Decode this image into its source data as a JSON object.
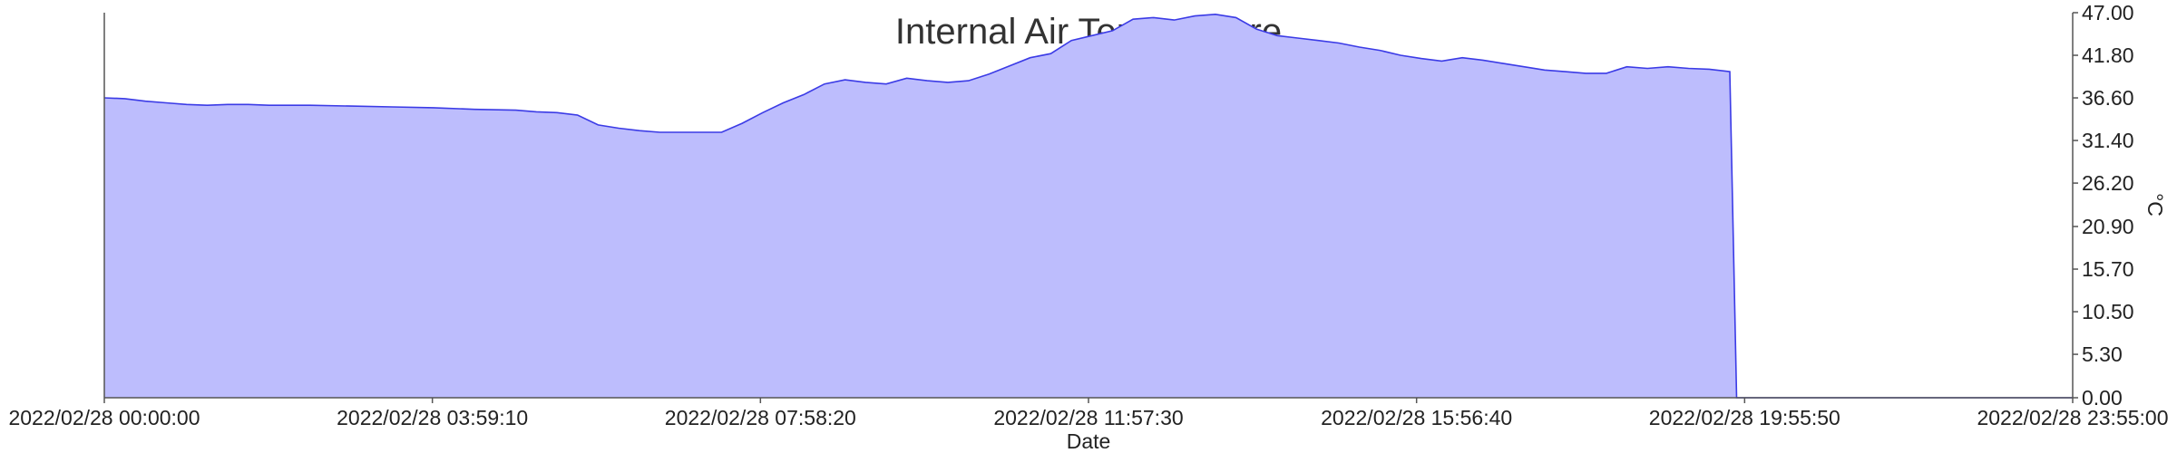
{
  "chart_data": {
    "type": "area",
    "title": "Internal Air Temperature",
    "xlabel": "Date",
    "ylabel": "°C",
    "y_axis_side": "right",
    "ylim": [
      0,
      47
    ],
    "y_ticks": [
      "0.00",
      "5.30",
      "10.50",
      "15.70",
      "20.90",
      "26.20",
      "31.40",
      "36.60",
      "41.80",
      "47.00"
    ],
    "x_ticks": [
      "2022/02/28 00:00:00",
      "2022/02/28 03:59:10",
      "2022/02/28 07:58:20",
      "2022/02/28 11:57:30",
      "2022/02/28 15:56:40",
      "2022/02/28 19:55:50",
      "2022/02/28 23:55:00"
    ],
    "grid": false,
    "fill_color": "#bdbdfd",
    "line_color": "#3b3be6",
    "series": [
      {
        "x": [
          "00:00",
          "00:15",
          "00:30",
          "00:45",
          "01:00",
          "01:15",
          "01:30",
          "01:45",
          "02:00",
          "02:30",
          "03:00",
          "03:30",
          "04:00",
          "04:30",
          "05:00",
          "05:15",
          "05:30",
          "05:45",
          "06:00",
          "06:15",
          "06:30",
          "06:45",
          "07:00",
          "07:15",
          "07:30",
          "07:45",
          "08:00",
          "08:15",
          "08:30",
          "08:45",
          "09:00",
          "09:15",
          "09:30",
          "09:45",
          "10:00",
          "10:15",
          "10:30",
          "10:45",
          "11:00",
          "11:15",
          "11:30",
          "11:45",
          "12:00",
          "12:15",
          "12:30",
          "12:45",
          "13:00",
          "13:15",
          "13:30",
          "13:45",
          "14:00",
          "14:15",
          "14:30",
          "14:45",
          "15:00",
          "15:15",
          "15:30",
          "15:45",
          "16:00",
          "16:15",
          "16:30",
          "16:45",
          "17:00",
          "17:15",
          "17:30",
          "17:45",
          "18:00",
          "18:15",
          "18:30",
          "18:45",
          "19:00",
          "19:15",
          "19:30",
          "19:45",
          "19:50",
          "19:55",
          "20:00",
          "20:30",
          "21:00",
          "22:00",
          "23:00",
          "23:55"
        ],
        "y": [
          36.6,
          36.5,
          36.2,
          36.0,
          35.8,
          35.7,
          35.8,
          35.8,
          35.7,
          35.7,
          35.6,
          35.5,
          35.4,
          35.2,
          35.1,
          34.9,
          34.8,
          34.5,
          33.3,
          32.9,
          32.6,
          32.4,
          32.4,
          32.4,
          32.4,
          33.5,
          34.8,
          36.0,
          37.0,
          38.3,
          38.8,
          38.5,
          38.3,
          39.0,
          38.7,
          38.5,
          38.7,
          39.5,
          40.5,
          41.5,
          42.0,
          43.6,
          44.2,
          44.8,
          46.2,
          46.4,
          46.1,
          46.6,
          46.8,
          46.4,
          45.0,
          44.2,
          43.9,
          43.6,
          43.3,
          42.8,
          42.4,
          41.8,
          41.4,
          41.1,
          41.5,
          41.2,
          40.8,
          40.4,
          40.0,
          39.8,
          39.6,
          39.6,
          40.4,
          40.2,
          40.4,
          40.2,
          40.1,
          39.8,
          0.0,
          0.0,
          0.0,
          0.0,
          0.0,
          0.0,
          0.0,
          0.0
        ]
      }
    ]
  }
}
